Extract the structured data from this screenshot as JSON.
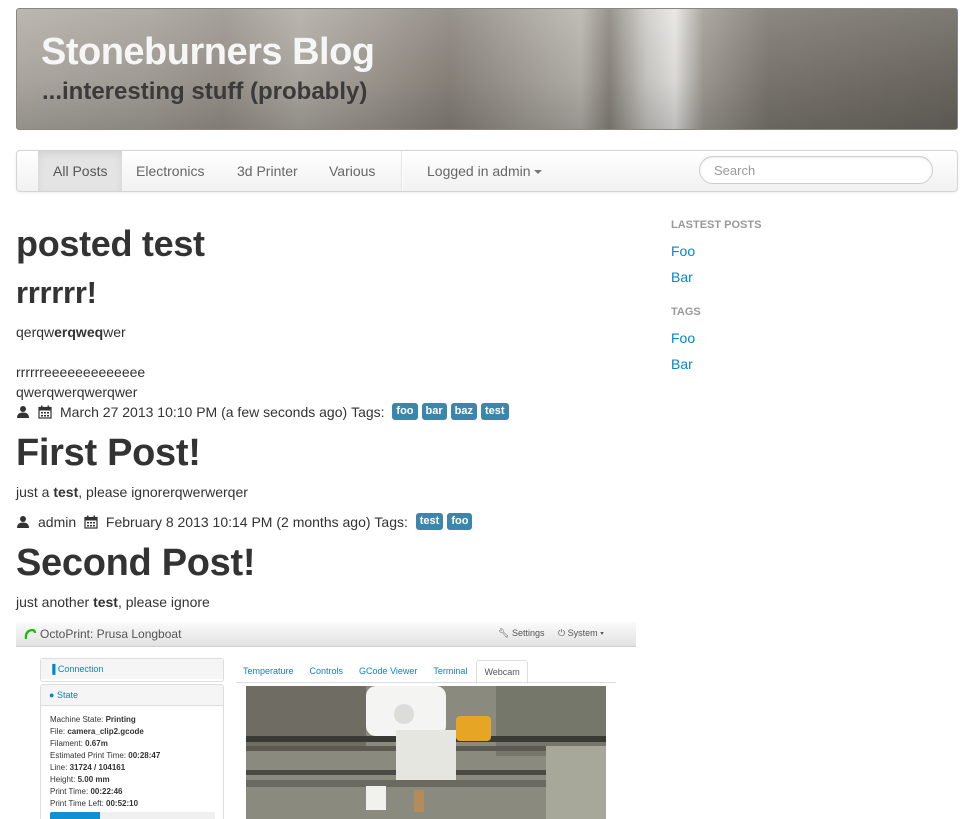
{
  "header": {
    "title": "Stoneburners Blog",
    "subtitle": "...interesting stuff (probably)"
  },
  "nav": {
    "items": [
      {
        "label": "All Posts",
        "active": true
      },
      {
        "label": "Electronics"
      },
      {
        "label": "3d Printer"
      },
      {
        "label": "Various"
      }
    ],
    "user_menu": "Logged in admin",
    "search_placeholder": "Search"
  },
  "posts": [
    {
      "title": "posted test",
      "subtitle": "rrrrrr!",
      "body_parts": [
        "qerqw",
        "erqweq",
        "wer"
      ],
      "line2": "rrrrrreeeeeeeeeeeee",
      "line3": "qwerqwerqwerqwer",
      "author": "",
      "date": "March 27 2013 10:10 PM (a few seconds ago)",
      "tags_label": "Tags:",
      "tags": [
        "foo",
        "bar",
        "baz",
        "test"
      ]
    },
    {
      "title": "First Post!",
      "body_parts": [
        "just a ",
        "test",
        ", please ignorerqwerwerqer"
      ],
      "author": "admin",
      "date": "February 8 2013 10:14 PM (2 months ago)",
      "tags_label": "Tags:",
      "tags": [
        "test",
        "foo"
      ]
    },
    {
      "title": "Second Post!",
      "body_parts": [
        "just another ",
        "test",
        ", please ignore"
      ]
    }
  ],
  "sidebar": {
    "latest_heading": "LASTEST POSTS",
    "latest": [
      "Foo",
      "Bar"
    ],
    "tags_heading": "TAGS",
    "tags": [
      "Foo",
      "Bar"
    ]
  },
  "embedded_screenshot": {
    "app_title": "OctoPrint: Prusa Longboat",
    "settings_label": "Settings",
    "system_label": "System",
    "connection_label": "Connection",
    "state_label": "State",
    "state_lines": [
      {
        "key": "Machine State: ",
        "value": "Printing"
      },
      {
        "key": "File: ",
        "value": "camera_clip2.gcode"
      },
      {
        "key": "Filament: ",
        "value": "0.67m"
      },
      {
        "key": "Estimated Print Time: ",
        "value": "00:28:47"
      },
      {
        "key": "Line: ",
        "value": "31724 / 104161"
      },
      {
        "key": "Height: ",
        "value": "5.00 mm"
      },
      {
        "key": "Print Time: ",
        "value": "00:22:46"
      },
      {
        "key": "Print Time Left: ",
        "value": "00:52:10"
      }
    ],
    "progress_fraction": 0.3,
    "tabs": [
      "Temperature",
      "Controls",
      "GCode Viewer",
      "Terminal",
      "Webcam"
    ],
    "active_tab": "Webcam"
  },
  "colors": {
    "link": "#0088cc",
    "tag_bg": "#3a87ad",
    "progress": "#0e90d2"
  }
}
